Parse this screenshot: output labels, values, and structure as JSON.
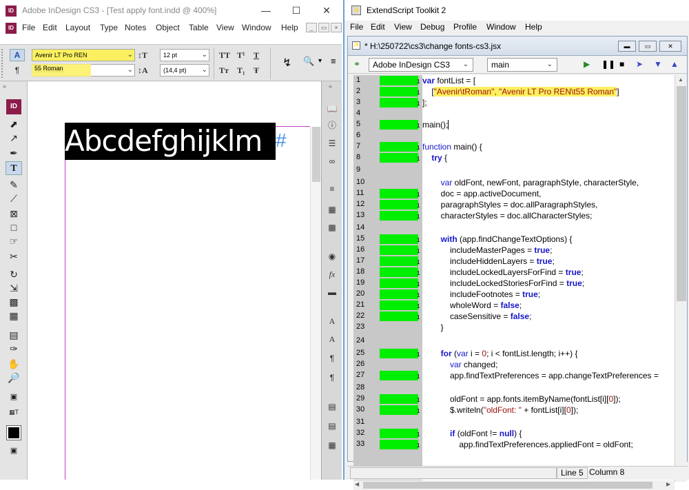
{
  "indesign": {
    "title": "Adobe InDesign CS3 - [Test apply font.indd @ 400%]",
    "logo": "ID",
    "menu": [
      "File",
      "Edit",
      "Layout",
      "Type",
      "Notes",
      "Object",
      "Table",
      "View",
      "Window",
      "Help"
    ],
    "font_family": "Avenir LT Pro REN",
    "font_style": "55 Roman",
    "font_size": "12 pt",
    "leading": "(14,4 pt)",
    "sample_text": "Abcdefghijklm",
    "end_marker": "#",
    "char_buttons": {
      "allcaps": "TT",
      "super": "T¹",
      "underline": "T",
      "smallcaps": "Tт",
      "sub": "T₁",
      "strike": "Ŧ"
    }
  },
  "extendscript": {
    "title": "ExtendScript Toolkit 2",
    "menu": [
      "File",
      "Edit",
      "View",
      "Debug",
      "Profile",
      "Window",
      "Help"
    ],
    "doc_title": "* H:\\250722\\cs3\\change fonts-cs3.jsx",
    "target_app": "Adobe InDesign CS3",
    "engine": "main",
    "status": {
      "line": "Line 5",
      "column": "Column 8"
    },
    "line_numbers": [
      "1",
      "2",
      "3",
      "4",
      "5",
      "6",
      "7",
      "8",
      "9",
      "10",
      "11",
      "12",
      "13",
      "14",
      "15",
      "16",
      "17",
      "18",
      "19",
      "20",
      "21",
      "22",
      "23",
      "24",
      "25",
      "26",
      "27",
      "28",
      "29",
      "30",
      "31",
      "32",
      "33"
    ],
    "breakpoint_lines": [
      1,
      2,
      3,
      5,
      7,
      8,
      11,
      12,
      13,
      15,
      16,
      17,
      18,
      19,
      20,
      21,
      22,
      25,
      27,
      29,
      30,
      32,
      33
    ]
  }
}
